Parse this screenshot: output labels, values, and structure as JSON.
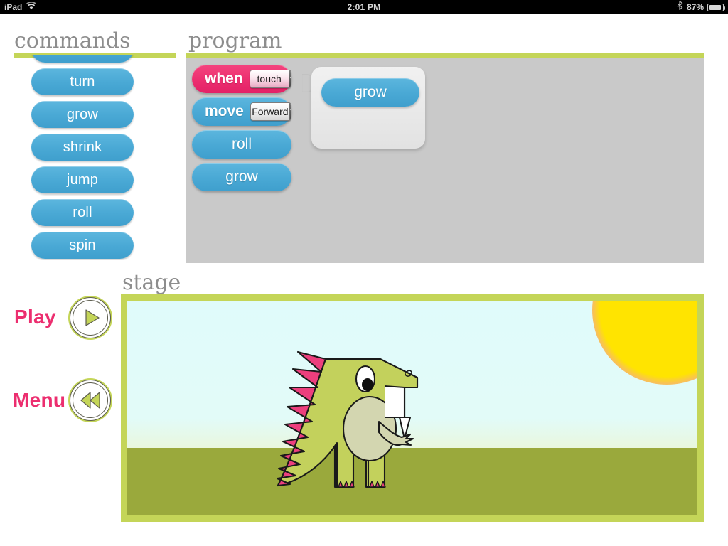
{
  "status_bar": {
    "carrier": "iPad",
    "wifi_icon": "wifi-icon",
    "time": "2:01 PM",
    "bluetooth_icon": "bluetooth-icon",
    "battery_percent": "87%",
    "battery_icon": "battery-icon"
  },
  "commands": {
    "title": "commands",
    "items": [
      {
        "label": "",
        "clipped": true
      },
      {
        "label": "turn",
        "clipped": false
      },
      {
        "label": "grow",
        "clipped": false
      },
      {
        "label": "shrink",
        "clipped": false
      },
      {
        "label": "jump",
        "clipped": false
      },
      {
        "label": "roll",
        "clipped": false
      },
      {
        "label": "spin",
        "clipped": false
      }
    ]
  },
  "program": {
    "title": "program",
    "blocks": [
      {
        "type": "event",
        "label": "when",
        "select_value": "touch"
      },
      {
        "type": "action",
        "label": "move",
        "select_value": "Forward"
      },
      {
        "type": "action",
        "label": "roll"
      },
      {
        "type": "action",
        "label": "grow"
      }
    ],
    "detached_script": {
      "blocks": [
        {
          "type": "action",
          "label": "grow"
        }
      ]
    }
  },
  "controls": {
    "play_label": "Play",
    "play_icon": "play-icon",
    "menu_label": "Menu",
    "menu_icon": "rewind-icon"
  },
  "stage": {
    "title": "stage",
    "sun_icon": "sun-icon",
    "sprite": "dinosaur-sprite"
  },
  "colors": {
    "accent_green": "#c4d558",
    "accent_pink": "#ec2e6f",
    "block_blue": "#4aa9d5",
    "canvas_gray": "#c9c9c9",
    "sky": "#e0fbfb",
    "ground": "#9aa93c",
    "sun": "#ffe400",
    "dino_body": "#c3d15c",
    "dino_spikes": "#ec3f7d"
  }
}
